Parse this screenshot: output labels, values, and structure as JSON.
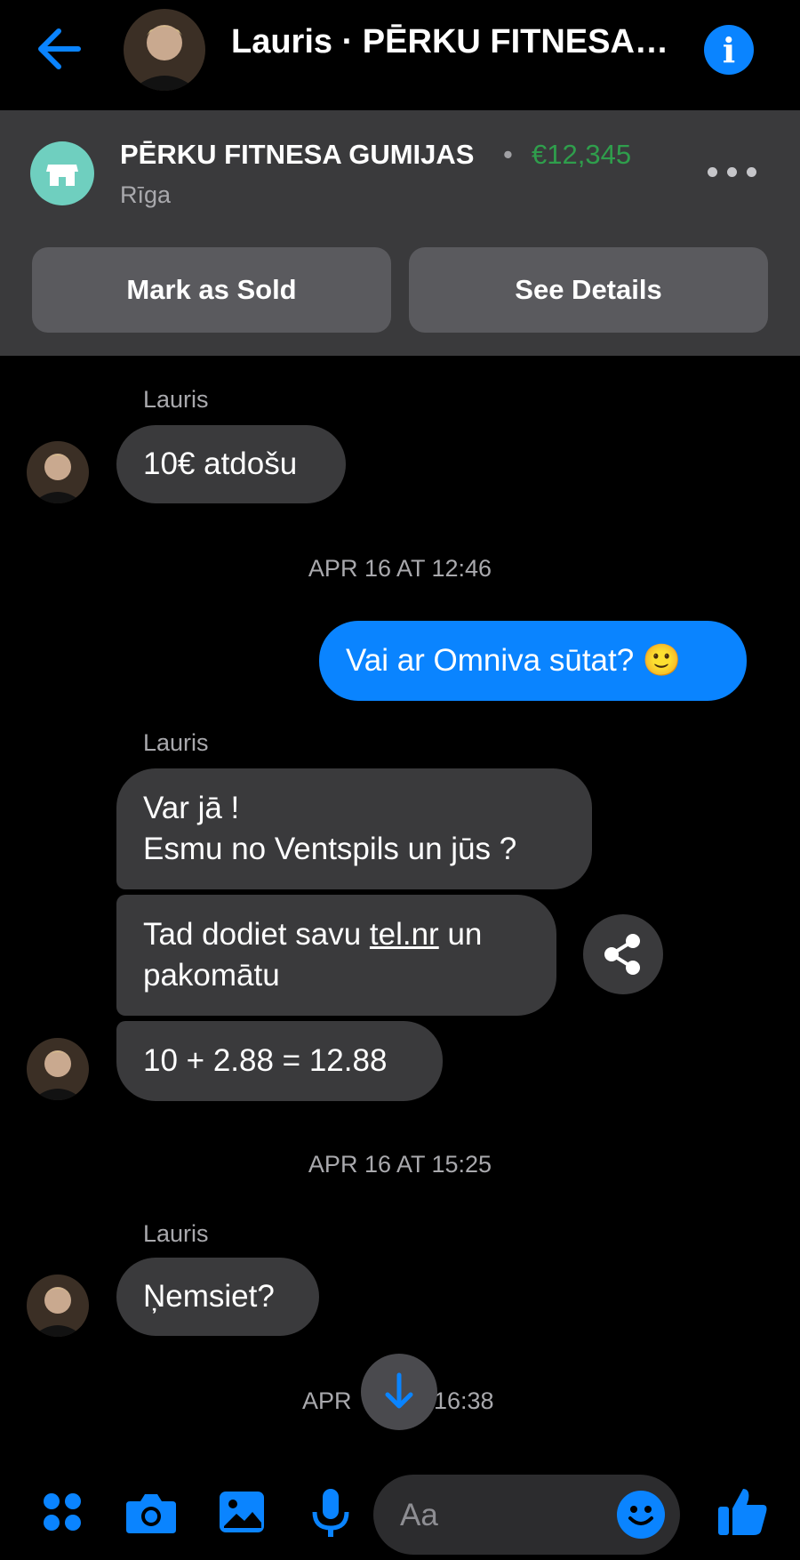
{
  "header": {
    "title": "Lauris · PĒRKU FITNESA…",
    "back_icon": "arrow-left-icon",
    "info_icon": "info-icon",
    "accent_color": "#0a84ff"
  },
  "listing": {
    "title": "PĒRKU FITNESA GUMIJAS",
    "separator": "•",
    "price": "€12,345",
    "location": "Rīga",
    "mark_sold_label": "Mark as Sold",
    "see_details_label": "See Details",
    "price_color": "#2f9e4c"
  },
  "messages": {
    "sender": "Lauris",
    "m1": "10€ atdošu",
    "ts1": "APR 16 AT 12:46",
    "out1": "Vai ar Omniva sūtat? 🙂",
    "m2_line1": "Var jā !",
    "m2_line2": "Esmu no Ventspils un jūs ?",
    "m3_prefix": "Tad dodiet savu ",
    "m3_link": "tel.nr",
    "m3_suffix": " un",
    "m3_line2": "pakomātu",
    "m4": "10 + 2.88 = 12.88",
    "ts2": "APR 16 AT 15:25",
    "m5": "Ņemsiet?",
    "ts3_left": "APR",
    "ts3_right": "16:38"
  },
  "composer": {
    "placeholder": "Aa",
    "icons": [
      "apps-icon",
      "camera-icon",
      "image-icon",
      "microphone-icon",
      "emoji-icon",
      "thumbs-up-icon"
    ]
  }
}
